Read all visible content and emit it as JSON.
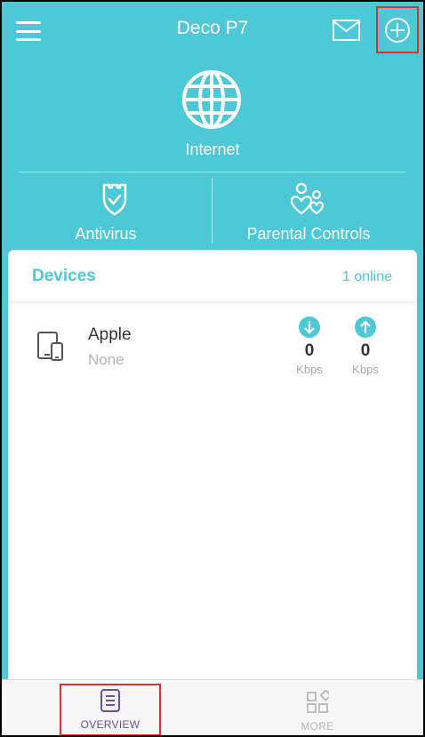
{
  "header": {
    "title": "Deco P7",
    "menu_icon": "hamburger-menu-icon",
    "mail_icon": "mail-icon",
    "add_icon": "add-circle-icon"
  },
  "network": {
    "internet_label": "Internet",
    "antivirus_label": "Antivirus",
    "parental_label": "Parental Controls"
  },
  "devices": {
    "title": "Devices",
    "online_count": "1 online",
    "items": [
      {
        "name": "Apple",
        "status": "None",
        "download_value": "0",
        "download_unit": "Kbps",
        "upload_value": "0",
        "upload_unit": "Kbps"
      }
    ]
  },
  "tabs": {
    "overview": "OVERVIEW",
    "more": "MORE"
  },
  "colors": {
    "primary": "#4dc8d6",
    "accent_purple": "#6b4fa0",
    "highlight_red": "#e0302d"
  }
}
